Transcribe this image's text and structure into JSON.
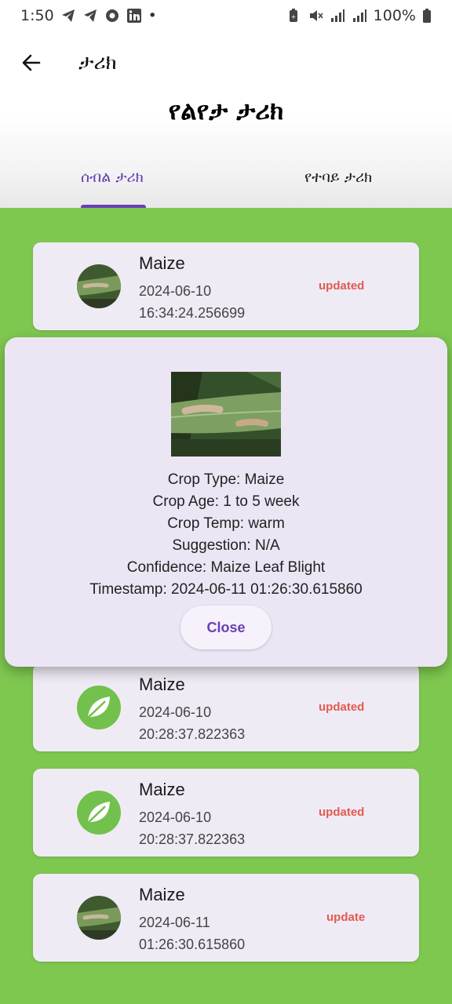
{
  "status_bar": {
    "time": "1:50",
    "dot": "•",
    "battery": "100%",
    "left_icons": [
      "telegram-icon",
      "telegram-icon",
      "chrome-icon",
      "linkedin-icon"
    ],
    "right_icons": [
      "battery-saver-icon",
      "mute-icon",
      "signal-icon",
      "signal-icon",
      "battery-icon"
    ]
  },
  "app_bar": {
    "title": "ታሪክ",
    "back_icon": "arrow-left-icon"
  },
  "page_title": "የልየታ ታሪክ",
  "tabs": [
    {
      "label": "ሰብል ታሪክ",
      "active": true
    },
    {
      "label": "የተባይ ታሪክ",
      "active": false
    }
  ],
  "colors": {
    "accent": "#6a3fb5",
    "background_green": "#7ec850",
    "card_bg": "#efebf5",
    "status_red": "#e25a4f",
    "leaf_green": "#72c14c"
  },
  "history_items": [
    {
      "name": "Maize",
      "date": "2024-06-10",
      "time": "16:34:24.256699",
      "status": "updated",
      "thumb": "maize-photo"
    },
    {
      "name": "Maize",
      "date": "2024-06-10",
      "time": "20:28:37.822363",
      "status": "updated",
      "thumb": "leaf-icon"
    },
    {
      "name": "Maize",
      "date": "2024-06-10",
      "time": "20:28:37.822363",
      "status": "updated",
      "thumb": "leaf-icon"
    },
    {
      "name": "Maize",
      "date": "2024-06-11",
      "time": "01:26:30.615860",
      "status": "update",
      "thumb": "maize-photo"
    }
  ],
  "dialog": {
    "crop_type": "Crop Type: Maize",
    "crop_age": "Crop Age: 1 to 5 week",
    "crop_temp": "Crop Temp: warm",
    "suggestion": "Suggestion: N/A",
    "confidence": "Confidence: Maize Leaf Blight",
    "timestamp": "Timestamp: 2024-06-11 01:26:30.615860",
    "close_label": "Close"
  }
}
